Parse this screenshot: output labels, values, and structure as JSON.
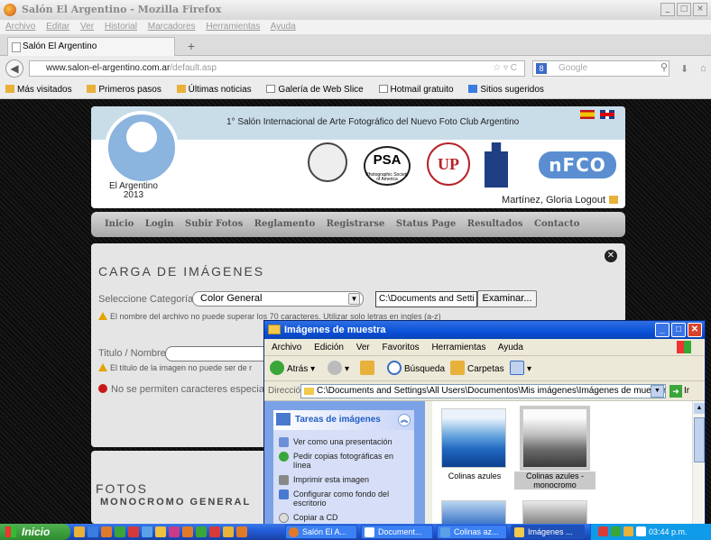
{
  "browser": {
    "window_title": "Salón El Argentino - Mozilla Firefox",
    "menu": [
      "Archivo",
      "Editar",
      "Ver",
      "Historial",
      "Marcadores",
      "Herramientas",
      "Ayuda"
    ],
    "tab_label": "Salón El Argentino",
    "newtab": "+",
    "url_host": "www.salon-el-argentino.com.ar",
    "url_path": "/default.asp",
    "search_placeholder": "Google",
    "bookmarks": [
      "Más visitados",
      "Primeros pasos",
      "Últimas noticias",
      "Galería de Web Slice",
      "Hotmail gratuito",
      "Sitios sugeridos"
    ]
  },
  "site": {
    "header_title": "1° Salón Internacional de Arte Fotográfico del Nuevo Foto Club Argentino",
    "club_name": "El Argentino",
    "club_year": "2013",
    "psa_text": "PSA",
    "psa_sub": "Photographic Society of America",
    "up_text": "UP",
    "nfco_text": "nFCO",
    "user_logout": "Martínez, Gloria Logout",
    "nav": [
      "Inicio",
      "Login",
      "Subir Fotos",
      "Reglamento",
      "Registrarse",
      "Status Page",
      "Resultados",
      "Contacto"
    ]
  },
  "form": {
    "heading": "CARGA DE IMÁGENES",
    "category_label": "Seleccione Categoría",
    "category_value": "Color General",
    "file_value": "C:\\Documents and Setti",
    "browse_button": "Examinar...",
    "warning_filename": "El nombre del archivo no puede superar los 70 caracteres. Utilizar solo letras en ingles (a-z)",
    "title_label": "Titulo / Nombre",
    "warning_title": "El título de la imagen no puede ser de r",
    "error_chars": "No se permiten caracteres especia"
  },
  "section2": {
    "heading": "FOTOS",
    "subheading": "MONOCROMO GENERAL"
  },
  "explorer": {
    "title": "Imágenes de muestra",
    "menu": [
      "Archivo",
      "Edición",
      "Ver",
      "Favoritos",
      "Herramientas",
      "Ayuda"
    ],
    "back": "Atrás",
    "search": "Búsqueda",
    "folders": "Carpetas",
    "address_label": "Dirección",
    "address_value": "C:\\Documents and Settings\\All Users\\Documentos\\Mis imágenes\\Imágenes de muestra",
    "go_label": "Ir",
    "tasks_title": "Tareas de imágenes",
    "tasks": [
      "Ver como una presentación",
      "Pedir copias fotográficas en línea",
      "Imprimir esta imagen",
      "Configurar como fondo del escritorio",
      "Copiar a CD"
    ],
    "thumbs": [
      "Colinas azules",
      "Colinas azules - monocromo"
    ]
  },
  "taskbar": {
    "start": "Inicio",
    "buttons": [
      "Salón El A...",
      "Document...",
      "Colinas az...",
      "Imágenes ..."
    ],
    "clock": "03:44 p.m."
  }
}
